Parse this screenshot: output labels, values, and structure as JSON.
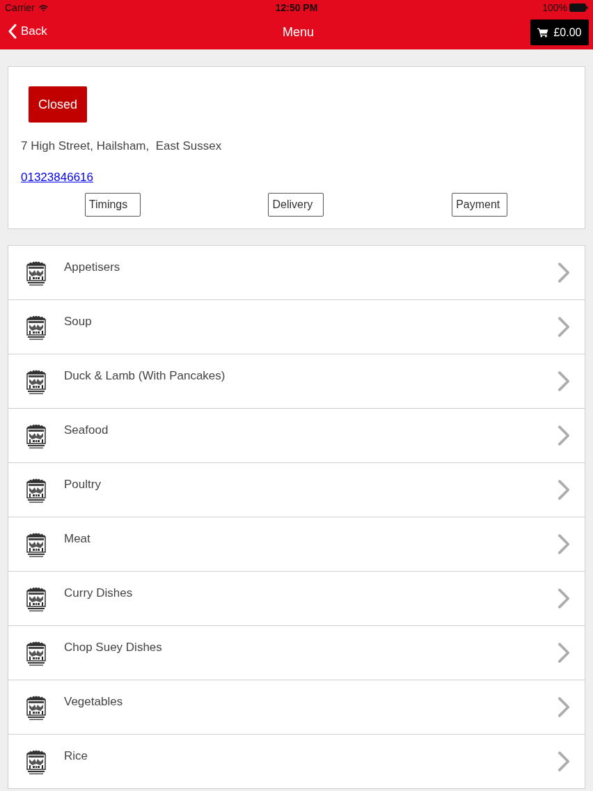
{
  "status_bar": {
    "carrier": "Carrier",
    "time": "12:50 PM",
    "battery": "100%"
  },
  "nav_bar": {
    "back": "Back",
    "title": "Menu",
    "cart_total": "£0.00"
  },
  "restaurant": {
    "status": "Closed",
    "address": "7 High Street, Hailsham,  East Sussex",
    "phone": "01323846616",
    "buttons": [
      "Timings",
      "Delivery",
      "Payment"
    ]
  },
  "categories": [
    "Appetisers",
    "Soup",
    "Duck & Lamb (With Pancakes)",
    "Seafood",
    "Poultry",
    "Meat",
    "Curry Dishes",
    "Chop Suey Dishes",
    "Vegetables",
    "Rice"
  ]
}
